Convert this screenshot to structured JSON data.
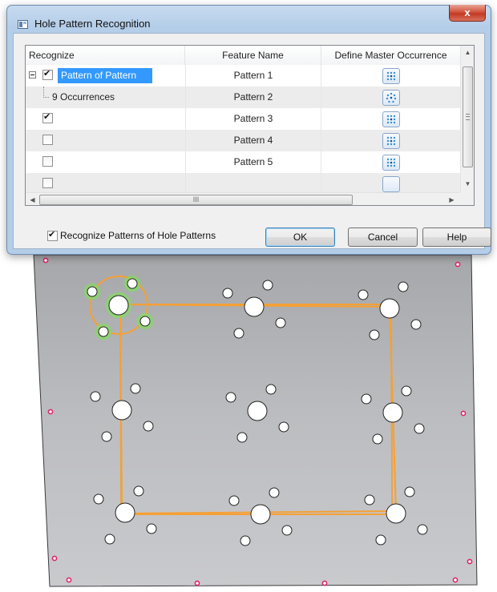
{
  "window": {
    "title": "Hole Pattern Recognition",
    "close_glyph": "x"
  },
  "grid": {
    "columns": [
      "Recognize",
      "Feature Name",
      "Define Master Occurrence"
    ],
    "rows": [
      {
        "label": "Pattern of Pattern",
        "feature": "Pattern 1",
        "checked": true,
        "selected": true,
        "icon": "rectangular-pattern-icon"
      },
      {
        "label": "9 Occurrences",
        "feature": "Pattern 2",
        "checked": false,
        "icon": "circular-pattern-icon"
      },
      {
        "label": "",
        "feature": "Pattern 3",
        "checked": true,
        "icon": "rectangular-pattern-icon"
      },
      {
        "label": "",
        "feature": "Pattern 4",
        "checked": false,
        "icon": "rectangular-pattern-icon"
      },
      {
        "label": "",
        "feature": "Pattern 5",
        "checked": false,
        "icon": "rectangular-pattern-icon"
      }
    ],
    "hscroll_grip": "III"
  },
  "options": {
    "recognize_patterns_label": "Recognize Patterns of Hole Patterns",
    "recognize_patterns_checked": true
  },
  "buttons": {
    "ok": "OK",
    "cancel": "Cancel",
    "help": "Help"
  },
  "colors": {
    "selection": "#3399ff",
    "pattern_outline": "#f5a035",
    "master_highlight": "#7fe05a",
    "corner_marker": "#e0246a",
    "plate": "#b9babd"
  }
}
